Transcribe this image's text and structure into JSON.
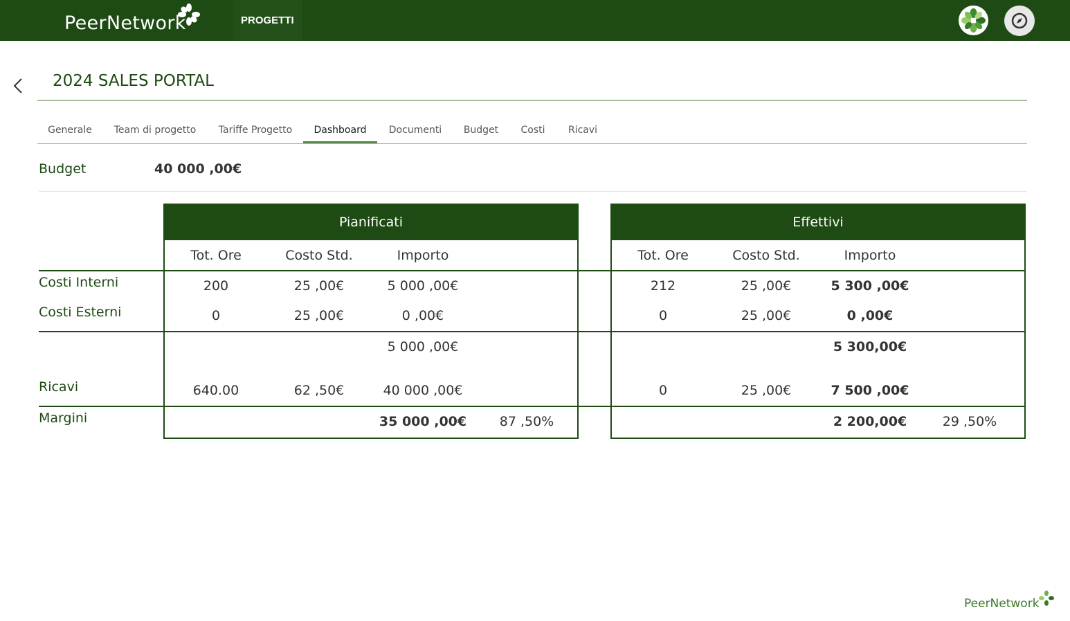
{
  "app": {
    "brand": "PeerNetwork",
    "nav_item": "PROGETTI"
  },
  "header": {
    "title": "2024 SALES PORTAL"
  },
  "tabs": [
    {
      "label": "Generale"
    },
    {
      "label": "Team di progetto"
    },
    {
      "label": "Tariffe Progetto"
    },
    {
      "label": "Dashboard",
      "active": true
    },
    {
      "label": "Documenti"
    },
    {
      "label": "Budget"
    },
    {
      "label": "Costi"
    },
    {
      "label": "Ricavi"
    }
  ],
  "budget": {
    "label": "Budget",
    "value": "40 000 ,00€"
  },
  "row_labels": {
    "costi_interni": "Costi Interni",
    "costi_esterni": "Costi Esterni",
    "ricavi": "Ricavi",
    "margini": "Margini"
  },
  "columns": [
    "Tot. Ore",
    "Costo Std.",
    "Importo"
  ],
  "pianificati": {
    "title": "Pianificati",
    "costi_interni": {
      "ore": "200",
      "costo_std": "25 ,00€",
      "importo": "5 000 ,00€"
    },
    "costi_esterni": {
      "ore": "0",
      "costo_std": "25 ,00€",
      "importo": "0 ,00€"
    },
    "totale_costi": "5 000 ,00€",
    "ricavi": {
      "ore": "640.00",
      "costo_std": "62 ,50€",
      "importo": "40 000 ,00€"
    },
    "margini": {
      "importo": "35 000 ,00€",
      "percent": "87 ,50%"
    }
  },
  "effettivi": {
    "title": "Effettivi",
    "costi_interni": {
      "ore": "212",
      "costo_std": "25 ,00€",
      "importo": "5 300 ,00€"
    },
    "costi_esterni": {
      "ore": "0",
      "costo_std": "25 ,00€",
      "importo": "0 ,00€"
    },
    "totale_costi": "5 300,00€",
    "ricavi": {
      "ore": "0",
      "costo_std": "25 ,00€",
      "importo": "7 500 ,00€"
    },
    "margini": {
      "importo": "2 200,00€",
      "percent": "29 ,50%"
    }
  },
  "colors": {
    "primary": "#1e4a14",
    "accent": "#5c8a4a",
    "logo_green": "#3a7a2a"
  },
  "icons": {
    "back": "chevron-left-icon",
    "avatar": "flower-avatar-icon",
    "compass": "compass-icon"
  }
}
